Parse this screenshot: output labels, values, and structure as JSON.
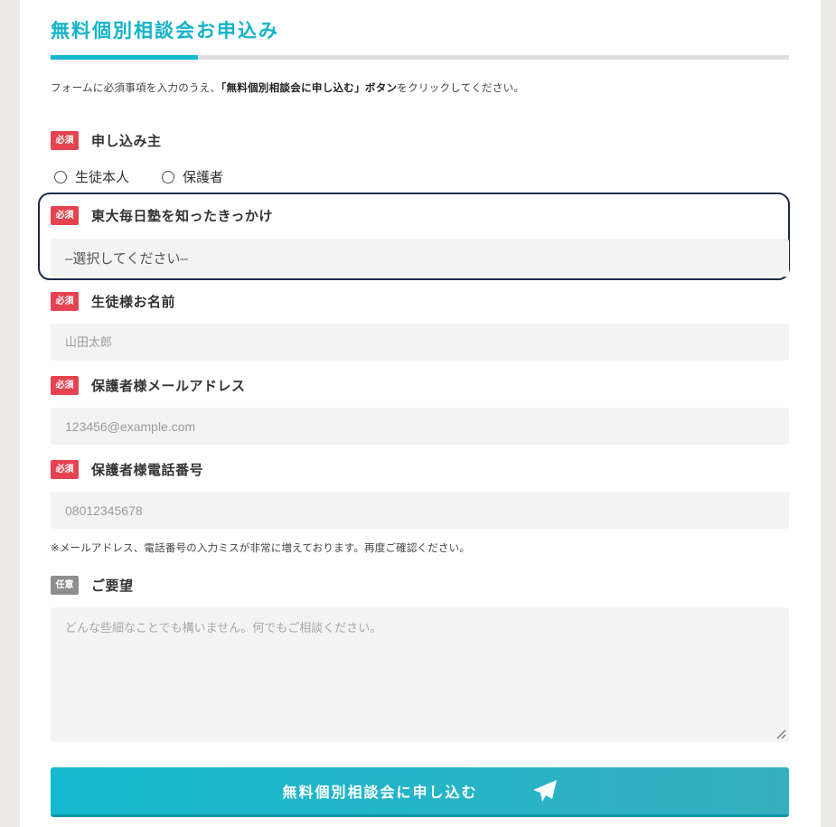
{
  "form": {
    "title": "無料個別相談会お申込み",
    "intro_prefix": "フォームに必須事項を入力のうえ、",
    "intro_bold": "「無料個別相談会に申し込む」ボタン",
    "intro_suffix": "をクリックしてください。",
    "accent_color": "#14b3c9",
    "required_badge": "必須",
    "optional_badge": "任意"
  },
  "applicant": {
    "label": "申し込み主",
    "options": [
      "生徒本人",
      "保護者"
    ]
  },
  "referral": {
    "label": "東大毎日塾を知ったきっかけ",
    "selected": "–選択してください–"
  },
  "student_name": {
    "label": "生徒様お名前",
    "placeholder": "山田太郎"
  },
  "email": {
    "label": "保護者様メールアドレス",
    "placeholder": "123456@example.com"
  },
  "phone": {
    "label": "保護者様電話番号",
    "placeholder": "08012345678"
  },
  "note": "※メールアドレス、電話番号の入力ミスが非常に増えております。再度ご確認ください。",
  "request": {
    "label": "ご要望",
    "placeholder": "どんな些細なことでも構いません。何でもご相談ください。"
  },
  "submit": {
    "label": "無料個別相談会に申し込む",
    "icon": "paper-plane-icon"
  }
}
